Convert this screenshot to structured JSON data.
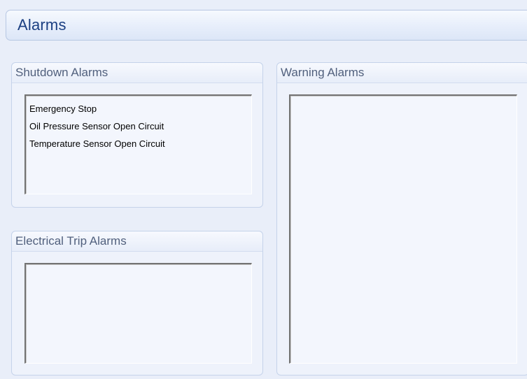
{
  "header": {
    "title": "Alarms"
  },
  "shutdown": {
    "title": "Shutdown Alarms",
    "items": [
      "Emergency Stop",
      "Oil Pressure Sensor Open Circuit",
      "Temperature Sensor Open Circuit"
    ]
  },
  "electrical_trip": {
    "title": "Electrical Trip Alarms",
    "items": []
  },
  "warning": {
    "title": "Warning Alarms",
    "items": []
  }
}
